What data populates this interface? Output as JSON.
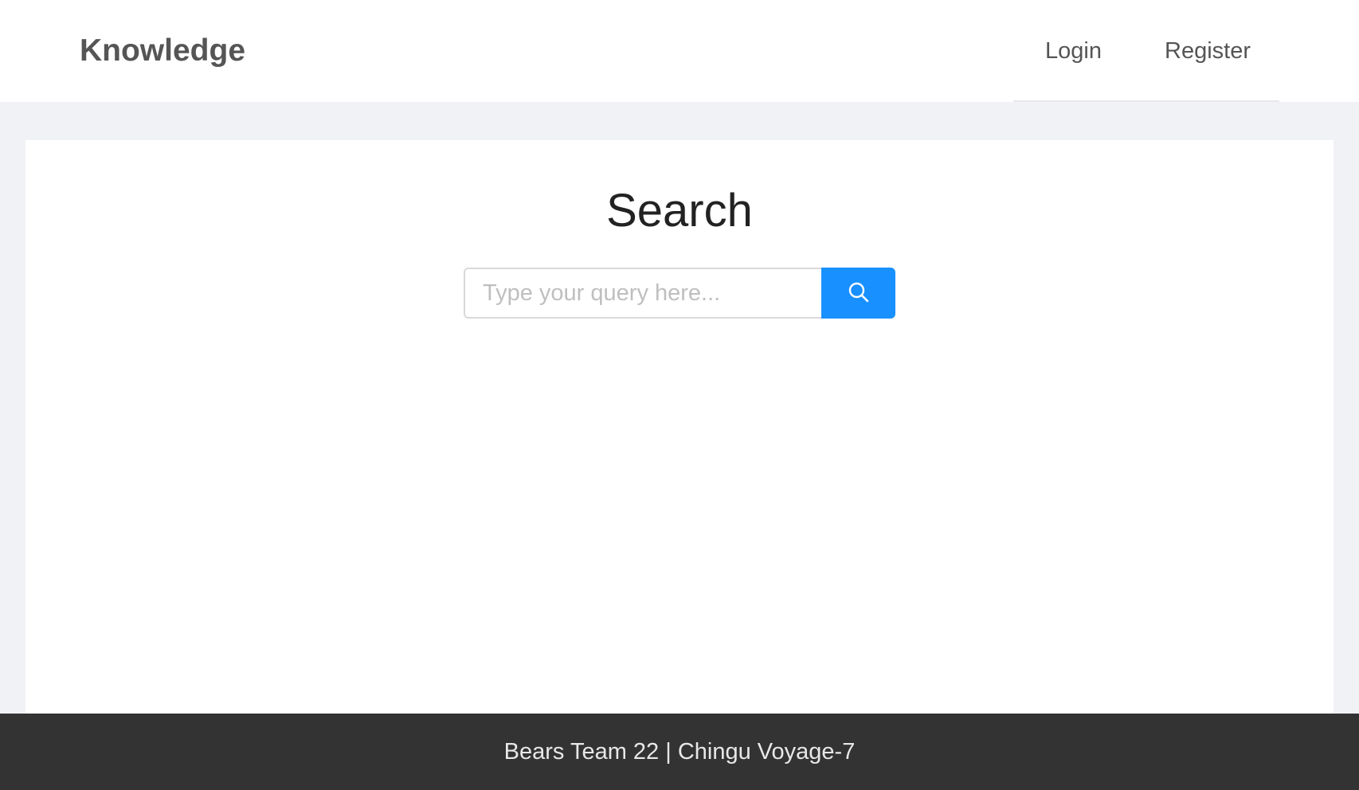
{
  "header": {
    "logo": "Knowledge",
    "nav": [
      {
        "label": "Login"
      },
      {
        "label": "Register"
      }
    ]
  },
  "main": {
    "title": "Search",
    "search": {
      "placeholder": "Type your query here...",
      "value": "",
      "button_icon": "search-icon"
    }
  },
  "footer": {
    "text": "Bears Team 22 | Chingu Voyage-7"
  },
  "colors": {
    "accent": "#1890ff",
    "background": "#f0f2f5",
    "footer": "#333333"
  }
}
